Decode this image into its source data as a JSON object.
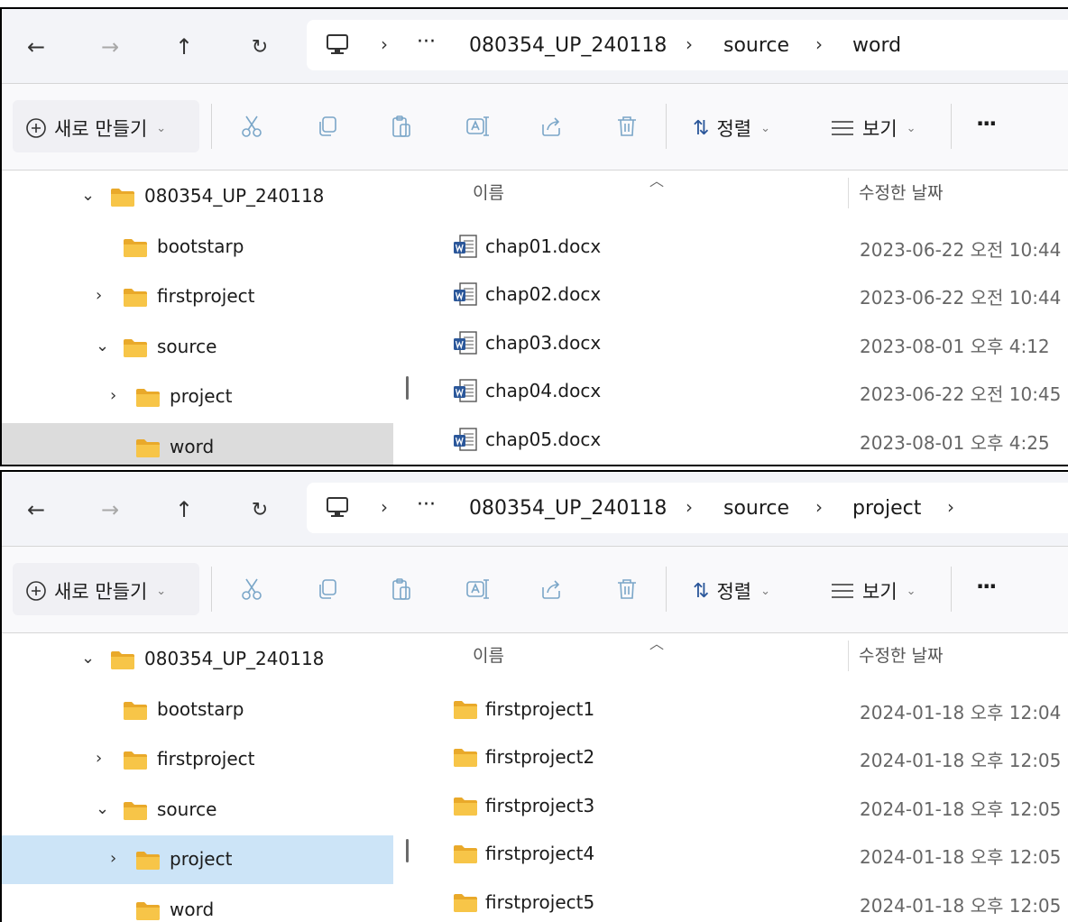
{
  "panels": [
    {
      "address": {
        "ellipsis": "···",
        "segments": [
          "080354_UP_240118",
          "source",
          "word"
        ],
        "trailing_chevron": false
      },
      "toolbar": {
        "new_label": "새로 만들기",
        "sort_label": "정렬",
        "view_label": "보기",
        "more_label": "···"
      },
      "nav": [
        {
          "label": "080354_UP_240118",
          "toggle": "⌄",
          "indent": 0,
          "state": "none"
        },
        {
          "label": "bootstarp",
          "toggle": "",
          "indent": 1,
          "state": "none"
        },
        {
          "label": "firstproject",
          "toggle": "›",
          "indent": 1,
          "state": "none"
        },
        {
          "label": "source",
          "toggle": "⌄",
          "indent": 1,
          "state": "none"
        },
        {
          "label": "project",
          "toggle": "›",
          "indent": 2,
          "state": "none"
        },
        {
          "label": "word",
          "toggle": "",
          "indent": 2,
          "state": "selected-gray"
        }
      ],
      "columns": {
        "name": "이름",
        "date": "수정한 날짜"
      },
      "files": [
        {
          "name": "chap01.docx",
          "date": "2023-06-22 오전 10:44",
          "kind": "word-doc-icon"
        },
        {
          "name": "chap02.docx",
          "date": "2023-06-22 오전 10:44",
          "kind": "word-doc-icon"
        },
        {
          "name": "chap03.docx",
          "date": "2023-08-01 오후 4:12",
          "kind": "word-doc-icon"
        },
        {
          "name": "chap04.docx",
          "date": "2023-06-22 오전 10:45",
          "kind": "word-doc-icon"
        },
        {
          "name": "chap05.docx",
          "date": "2023-08-01 오후 4:25",
          "kind": "word-doc-icon"
        }
      ]
    },
    {
      "address": {
        "ellipsis": "···",
        "segments": [
          "080354_UP_240118",
          "source",
          "project"
        ],
        "trailing_chevron": true
      },
      "toolbar": {
        "new_label": "새로 만들기",
        "sort_label": "정렬",
        "view_label": "보기",
        "more_label": "···"
      },
      "nav": [
        {
          "label": "080354_UP_240118",
          "toggle": "⌄",
          "indent": 0,
          "state": "none"
        },
        {
          "label": "bootstarp",
          "toggle": "",
          "indent": 1,
          "state": "none"
        },
        {
          "label": "firstproject",
          "toggle": "›",
          "indent": 1,
          "state": "none"
        },
        {
          "label": "source",
          "toggle": "⌄",
          "indent": 1,
          "state": "none"
        },
        {
          "label": "project",
          "toggle": "›",
          "indent": 2,
          "state": "selected-blue"
        },
        {
          "label": "word",
          "toggle": "",
          "indent": 2,
          "state": "none"
        }
      ],
      "columns": {
        "name": "이름",
        "date": "수정한 날짜"
      },
      "files": [
        {
          "name": "firstproject1",
          "date": "2024-01-18 오후 12:04",
          "kind": "folder-icon"
        },
        {
          "name": "firstproject2",
          "date": "2024-01-18 오후 12:05",
          "kind": "folder-icon"
        },
        {
          "name": "firstproject3",
          "date": "2024-01-18 오후 12:05",
          "kind": "folder-icon"
        },
        {
          "name": "firstproject4",
          "date": "2024-01-18 오후 12:05",
          "kind": "folder-icon"
        },
        {
          "name": "firstproject5",
          "date": "2024-01-18 오후 12:05",
          "kind": "folder-icon"
        }
      ]
    }
  ],
  "colors": {
    "folder": "#f7c548",
    "folder_dark": "#e9a92a",
    "word_blue": "#2b579a",
    "nav_selected_gray": "#dcdcdc",
    "nav_selected_blue": "#cce4f7"
  }
}
